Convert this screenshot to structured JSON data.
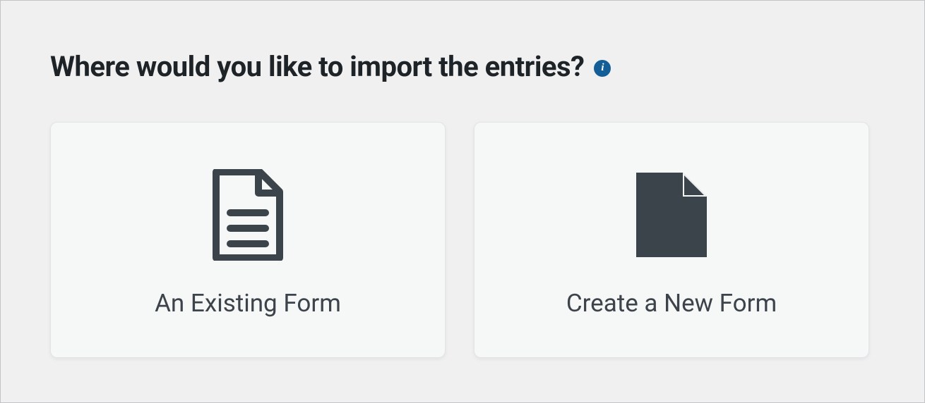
{
  "header": {
    "title": "Where would you like to import the entries?",
    "info_icon_label": "i"
  },
  "options": {
    "existing_form": {
      "label": "An Existing Form"
    },
    "new_form": {
      "label": "Create a New Form"
    }
  }
}
